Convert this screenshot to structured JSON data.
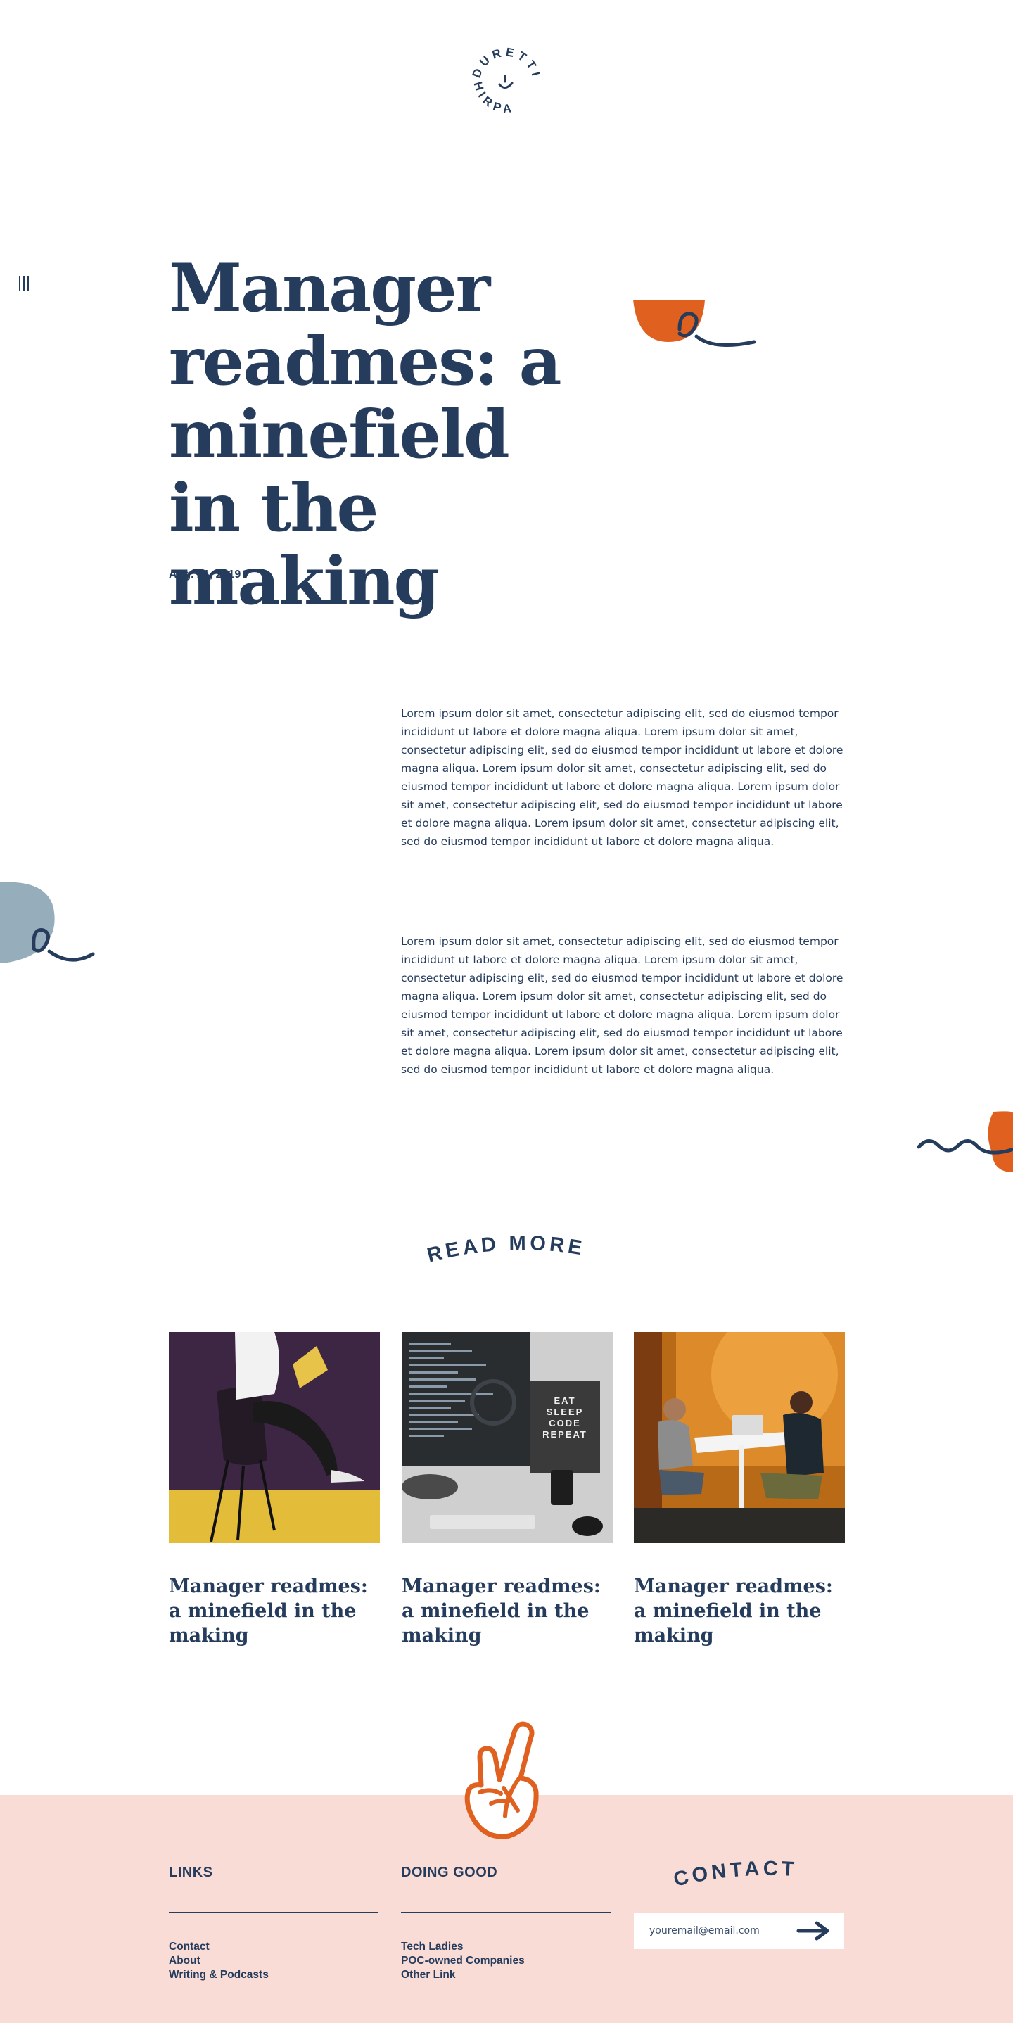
{
  "brand": {
    "logo_top": "DURETTI",
    "logo_bottom": "HIRPA",
    "navy": "#263c5d",
    "orange": "#e0601f",
    "slate": "#96aebb",
    "footer_pink": "#f9dcd6"
  },
  "menu": {
    "icon": "menu-icon"
  },
  "hero": {
    "title": "Manager readmes: a minefield in the making",
    "date": "Aug. 21, 2019"
  },
  "article": {
    "paragraphs": [
      "Lorem ipsum dolor sit amet, consectetur adipiscing elit, sed do eiusmod tempor incididunt ut labore et dolore magna aliqua. Lorem ipsum dolor sit amet, consectetur adipiscing elit, sed do eiusmod tempor incididunt ut labore et dolore magna aliqua. Lorem ipsum dolor sit amet, consectetur adipiscing elit, sed do eiusmod tempor incididunt ut labore et dolore magna aliqua. Lorem ipsum dolor sit amet, consectetur adipiscing elit, sed do eiusmod tempor incididunt ut labore et dolore magna aliqua. Lorem ipsum dolor sit amet, consectetur adipiscing elit, sed do eiusmod tempor incididunt ut labore et dolore magna aliqua.",
      "Lorem ipsum dolor sit amet, consectetur adipiscing elit, sed do eiusmod tempor incididunt ut labore et dolore magna aliqua. Lorem ipsum dolor sit amet, consectetur adipiscing elit, sed do eiusmod tempor incididunt ut labore et dolore magna aliqua. Lorem ipsum dolor sit amet, consectetur adipiscing elit, sed do eiusmod tempor incididunt ut labore et dolore magna aliqua. Lorem ipsum dolor sit amet, consectetur adipiscing elit, sed do eiusmod tempor incididunt ut labore et dolore magna aliqua. Lorem ipsum dolor sit amet, consectetur adipiscing elit, sed do eiusmod tempor incididunt ut labore et dolore magna aliqua."
    ]
  },
  "read_more": {
    "label": "READ MORE"
  },
  "cards": [
    {
      "title": "Manager readmes: a minefield in the making",
      "image": "person-reading-on-chair"
    },
    {
      "title": "Manager readmes: a minefield in the making",
      "image": "computer-desk",
      "sign_lines": [
        "EAT",
        "SLEEP",
        "CODE",
        "REPEAT"
      ]
    },
    {
      "title": "Manager readmes: a minefield in the making",
      "image": "two-people-meeting"
    }
  ],
  "footer": {
    "links_heading": "LINKS",
    "links": [
      "Contact",
      "About",
      "Writing & Podcasts"
    ],
    "doing_good_heading": "DOING GOOD",
    "doing_good": [
      "Tech Ladies",
      "POC-owned Companies",
      "Other Link"
    ],
    "contact_heading": "CONTACT",
    "email_placeholder": "youremail@email.com",
    "submit_icon": "arrow-right-icon"
  }
}
